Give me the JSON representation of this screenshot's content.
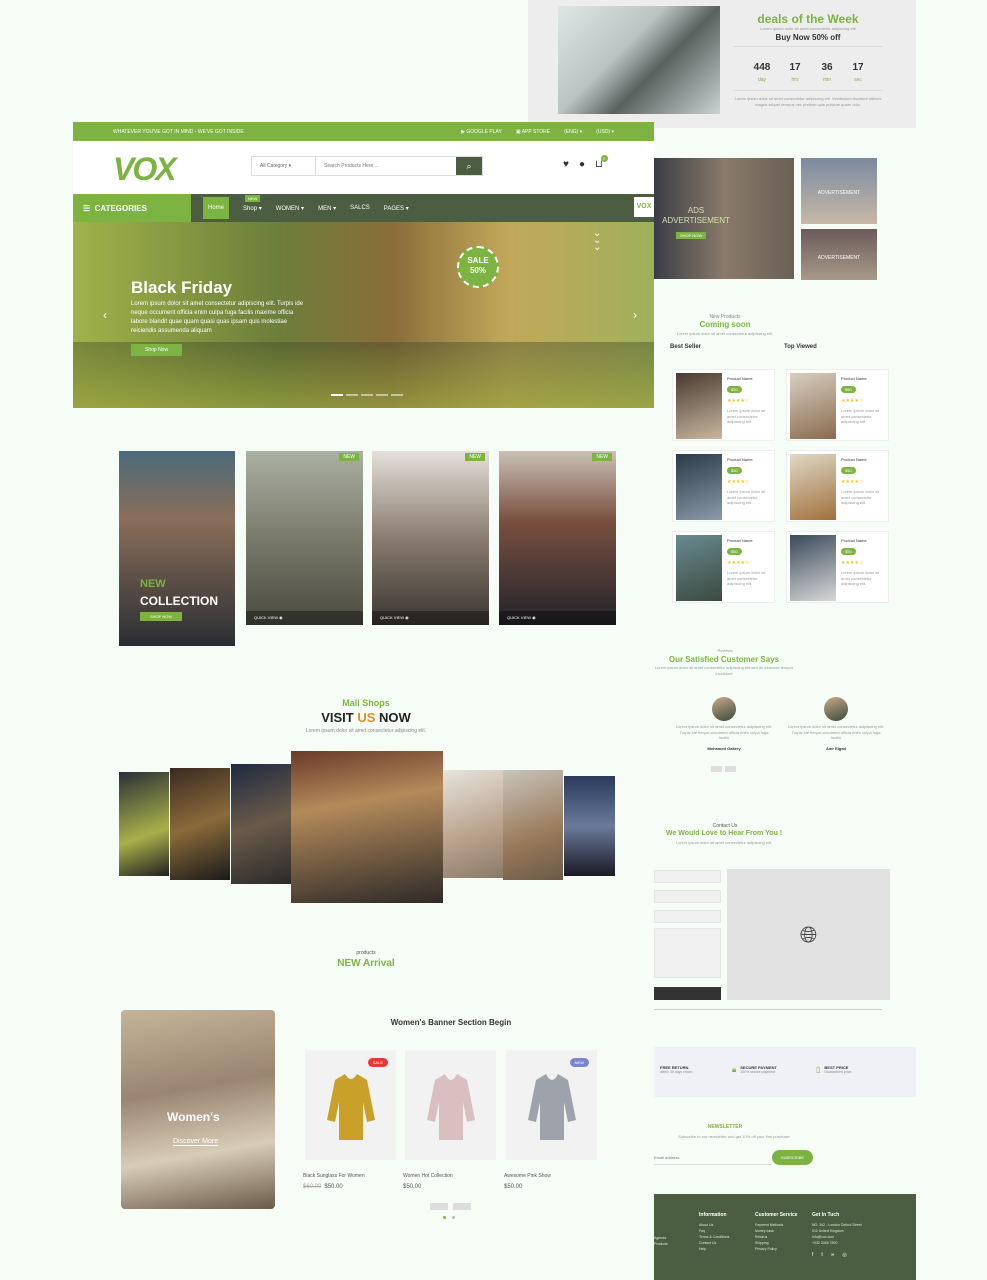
{
  "deals": {
    "title": "deals of the Week",
    "desc": "Lorem ipsum dolor sit amet consectetur adipiscing elit",
    "offer": "Buy Now 50% off",
    "countdown": [
      {
        "value": "448",
        "unit": "day"
      },
      {
        "value": "17",
        "unit": "hrs"
      },
      {
        "value": "36",
        "unit": "min"
      },
      {
        "value": "17",
        "unit": "sec"
      }
    ],
    "footer_text": "Lorem ipsum dolor sit amet consectetur adipiscing elit. Vestibulum tincidunt ultrices magna aliquet tempus nec pretium quis pulvinar quam odio."
  },
  "topbar": {
    "tagline": "WHATEVER YOU'VE GOT IN MIND - WE'VE GOT INSIDE",
    "google_play": "GOOGLE PLAY",
    "app_store": "APP STORE",
    "lang": "(ENG)",
    "currency": "(USD)"
  },
  "header": {
    "logo": "VOX",
    "category_select": "All Category",
    "search_placeholder": "Search Products Here ...",
    "cart_count": "0"
  },
  "nav": {
    "categories": "CATEGORIES",
    "items": [
      "Home",
      "Shop",
      "WOMEN",
      "MEN",
      "SALCS",
      "PAGES"
    ],
    "new_badge": "NEW",
    "mini_logo": "VOX"
  },
  "hero": {
    "title": "Black Friday",
    "text": "Lorem ipsum dolor sit amet consectetur adipiscing elit. Turpis ide neque occument officia enim culpa fuga facilis maxime officia labore blandit quae quam quasi quas ipsam quis molestiae reiciendis assumenda aliquam",
    "button": "Shop Now",
    "sale_line1": "SALE",
    "sale_line2": "50%"
  },
  "collection": {
    "line1": "NEW",
    "line2": "COLLECTION",
    "button": "SHOP NOW",
    "tiles": [
      {
        "badge": "NEW",
        "quick_view": "QUICK VIEW"
      },
      {
        "badge": "NEW",
        "quick_view": "QUICK VIEW"
      },
      {
        "badge": "NEW",
        "quick_view": "QUICK VIEW"
      }
    ]
  },
  "mall": {
    "subtitle": "Mall Shops",
    "title_a": "VISIT ",
    "title_b": "US",
    "title_c": " NOW",
    "desc": "Lorem ipsum dolor sit amet consectetur adipiscing elit."
  },
  "arrival": {
    "subtitle": "products",
    "title": "NEW Arrival"
  },
  "women": {
    "banner_title": "Women's",
    "banner_link": "Discover More",
    "section_title": "Women's Banner Section Begin",
    "products": [
      {
        "name": "Black Sunglass For Women",
        "old_price": "$60.00",
        "price": "$50.00",
        "badge": "SALE",
        "badge_color": "#e53935"
      },
      {
        "name": "Women Hot Collection",
        "old_price": "",
        "price": "$50.00",
        "badge": "",
        "badge_color": ""
      },
      {
        "name": "Awesome Pink Show",
        "old_price": "",
        "price": "$50.00",
        "badge": "NEW",
        "badge_color": "#7986cb"
      }
    ]
  },
  "ads": {
    "main_line1": "ADS",
    "main_line2": "ADVERTISEMENT",
    "main_button": "SHOP NOW",
    "small1": "ADVERTISEMENT",
    "small2": "ADVERTISEMENT"
  },
  "new_products": {
    "subtitle": "New Products",
    "title": "Coming soon",
    "desc": "Lorem ipsum dolor sit amet consectetur adipiscing elit.",
    "best_seller": "Best Seller",
    "top_viewed": "Top Viewed",
    "card": {
      "name": "Product Name",
      "price": "$50",
      "stars": "★★★★☆",
      "desc": "Lorem ipsum dolor sit amet consectetur adipiscing elit."
    }
  },
  "reviews": {
    "subtitle": "Reviews",
    "title": "Our Satisfied Customer Says",
    "desc": "Lorem ipsum dolor sit amet consectetur adipiscing elit sed do eiusmod tempor incididunt",
    "quote": "Lorem ipsum dolor sit amet consectetur adipiscing elit. Turpis ide neque occument officia enim culpa fuga facilis",
    "names": [
      "Mohamed Gallery",
      "Amr Elgad"
    ],
    "badge": "4"
  },
  "contact": {
    "subtitle": "Contact Us",
    "title": "We Would Love to Hear From You !",
    "desc": "Lorem ipsum dolor sit amet consectetur adipiscing elit."
  },
  "features": [
    {
      "icon": "truck-icon",
      "title": "FREE RETURN",
      "desc": "within 30 days return"
    },
    {
      "icon": "lock-icon",
      "title": "SECURE PAYMENT",
      "desc": "100% secure payment"
    },
    {
      "icon": "tag-icon",
      "title": "BEST PRICE",
      "desc": "Guaranteed price"
    }
  ],
  "newsletter": {
    "title": "NEWSLETTER",
    "desc": "Subscribe to our newsletter and get 10% off your first purchase",
    "placeholder": "Email address",
    "button": "SUBSCRIBE"
  },
  "footer": {
    "left_items": [
      "Agenda",
      "Products"
    ],
    "information": {
      "title": "Information",
      "items": [
        "About Us",
        "Faq",
        "Terms & Conditions",
        "Contact Us",
        "Help"
      ]
    },
    "service": {
      "title": "Customer Service",
      "items": [
        "Payment Methods",
        "Money-back",
        "Returns",
        "Shipping",
        "Privacy Policy"
      ]
    },
    "touch": {
      "title": "Get In Tuch",
      "items": [
        "NO. 342 - London Oxford Street",
        "012 United Kingdom",
        "info@vox.com",
        "+032 3456 7890"
      ]
    }
  },
  "colors": {
    "accent": "#7cb342",
    "dark": "#4b5e41"
  }
}
